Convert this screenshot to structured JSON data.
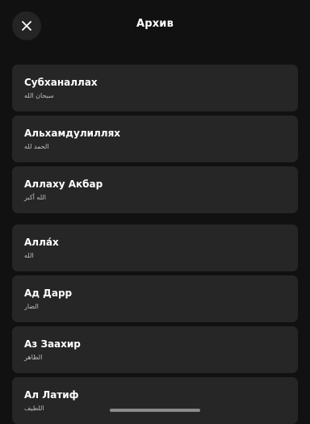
{
  "header": {
    "title": "Архив",
    "close_icon": "close-icon"
  },
  "items": [
    {
      "title": "Субханаллах",
      "arabic": "سبحان الله"
    },
    {
      "title": "Альхамдулиллях",
      "arabic": "الحمد لله"
    },
    {
      "title": "Аллаху Акбар",
      "arabic": "الله أكبر"
    },
    {
      "title": "Алла́х",
      "arabic": "الله"
    },
    {
      "title": "Ад Дарр",
      "arabic": "الضار"
    },
    {
      "title": "Аз Заахир",
      "arabic": "الظاهر"
    },
    {
      "title": "Ал Латиф",
      "arabic": "اللطيف"
    }
  ],
  "colors": {
    "background": "#111111",
    "card": "#262626",
    "text": "#ffffff",
    "subtext": "#bfbfbf"
  }
}
